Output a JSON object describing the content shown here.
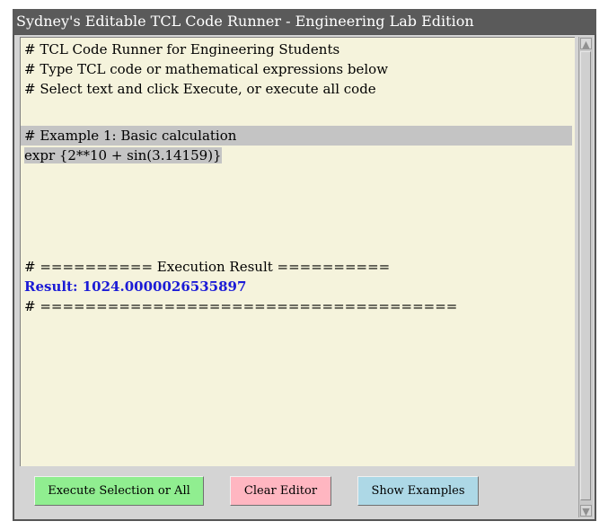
{
  "window": {
    "title": "Sydney's Editable TCL Code Runner - Engineering Lab Edition"
  },
  "editor": {
    "lines": [
      "# TCL Code Runner for Engineering Students",
      "# Type TCL code or mathematical expressions below",
      "# Select text and click Execute, or execute all code",
      "",
      "# Example 1: Basic calculation",
      "expr {2**10 + sin(3.14159)}",
      "",
      "",
      "",
      "",
      "",
      "# ========== Execution Result ==========",
      "Result: 1024.0000026535897",
      "# ====================================="
    ],
    "selection_highlight_color": "#c4c4c4",
    "result_color": "#1b1bd6",
    "background_color": "#f5f3dc"
  },
  "buttons": {
    "execute_label": "Execute Selection or All",
    "execute_color": "#90ee90",
    "clear_label": "Clear Editor",
    "clear_color": "#ffb6c1",
    "examples_label": "Show Examples",
    "examples_color": "#add8e6"
  },
  "scrollbar": {
    "up_icon": "arrow-up-icon",
    "down_icon": "arrow-down-icon"
  }
}
